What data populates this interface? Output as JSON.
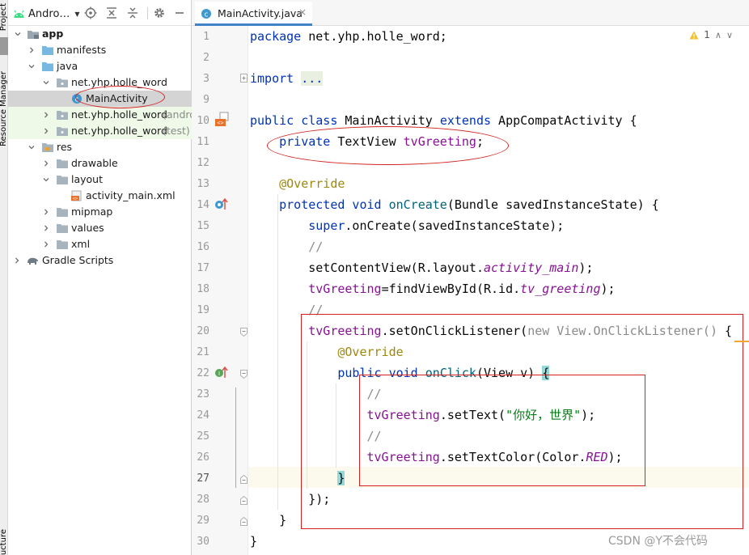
{
  "side_strip": {
    "project_tab": "Project",
    "resource_manager_tab": "Resource Manager",
    "structure_tab": "Structure"
  },
  "project_panel": {
    "view_selector": "Andro…",
    "tree": [
      {
        "label": "app",
        "icon": "app-module-icon"
      },
      {
        "label": "manifests",
        "icon": "folder-icon"
      },
      {
        "label": "java",
        "icon": "folder-icon"
      },
      {
        "label": "net.yhp.holle_word",
        "icon": "package-icon"
      },
      {
        "label": "MainActivity",
        "icon": "java-class-icon",
        "selected": true
      },
      {
        "label": "net.yhp.holle_word",
        "suffix": "(andro",
        "icon": "package-icon"
      },
      {
        "label": "net.yhp.holle_word",
        "suffix": "(test)",
        "icon": "package-icon"
      },
      {
        "label": "res",
        "icon": "folder-icon"
      },
      {
        "label": "drawable",
        "icon": "folder-icon"
      },
      {
        "label": "layout",
        "icon": "folder-icon"
      },
      {
        "label": "activity_main.xml",
        "icon": "xml-layout-icon"
      },
      {
        "label": "mipmap",
        "icon": "folder-icon"
      },
      {
        "label": "values",
        "icon": "folder-icon"
      },
      {
        "label": "xml",
        "icon": "folder-icon"
      },
      {
        "label": "Gradle Scripts",
        "icon": "gradle-elephant-icon"
      }
    ]
  },
  "editor": {
    "tab": {
      "label": "MainActivity.java",
      "close": "×"
    },
    "inspection": {
      "warning_count": "1",
      "up": "∧",
      "down": "∨"
    },
    "line_numbers": [
      "1",
      "2",
      "3",
      "9",
      "10",
      "11",
      "12",
      "13",
      "14",
      "15",
      "16",
      "17",
      "18",
      "19",
      "20",
      "21",
      "22",
      "23",
      "24",
      "25",
      "26",
      "27",
      "28",
      "29",
      "30"
    ],
    "code": {
      "l1_kw": "package",
      "l1_rest": " net.yhp.holle_word;",
      "l3_kw": "import",
      "l3_fold": "...",
      "l10_kw1": "public class",
      "l10_name": " MainActivity ",
      "l10_kw2": "extends",
      "l10_rest": " AppCompatActivity {",
      "l11_kw": "private",
      "l11_type": " TextView ",
      "l11_field": "tvGreeting",
      "l11_end": ";",
      "l13_ann": "@Override",
      "l14_kw": "protected void",
      "l14_fn": " onCreate",
      "l14_rest": "(Bundle savedInstanceState) {",
      "l15_kw": "super",
      "l15_rest": ".onCreate(savedInstanceState);",
      "l16_cm": "//",
      "l17_a": "setContentView(R.layout.",
      "l17_b": "activity_main",
      "l17_c": ");",
      "l18_field": "tvGreeting",
      "l18_a": "=findViewById(R.id.",
      "l18_b": "tv_greeting",
      "l18_c": ");",
      "l19_cm": "//",
      "l20_field": "tvGreeting",
      "l20_a": ".setOnClickListener(",
      "l20_gray": "new View.OnClickListener()",
      "l20_b": " {",
      "l21_ann": "@Override",
      "l22_kw": "public void",
      "l22_fn": " onClick",
      "l22_a": "(View v) ",
      "l22_brace": "{",
      "l23_cm": "//",
      "l24_field": "tvGreeting",
      "l24_a": ".setText(",
      "l24_str": "\"你好，世界\"",
      "l24_b": ");",
      "l25_cm": "//",
      "l26_field": "tvGreeting",
      "l26_a": ".setTextColor(Color.",
      "l26_const": "RED",
      "l26_b": ");",
      "l27_brace": "}",
      "l28": "});",
      "l29": "}",
      "l30": "}"
    }
  },
  "watermark": "CSDN @Y不会代码",
  "colors": {
    "keyword": "#0033b3",
    "field": "#871094",
    "annotation": "#9e880d",
    "method": "#00627a",
    "comment": "#8c8c8c",
    "string": "#067d17",
    "annotation_markup": "#d42121",
    "selection": "#d4d4d4",
    "package_highlight": "#eef9e8"
  }
}
